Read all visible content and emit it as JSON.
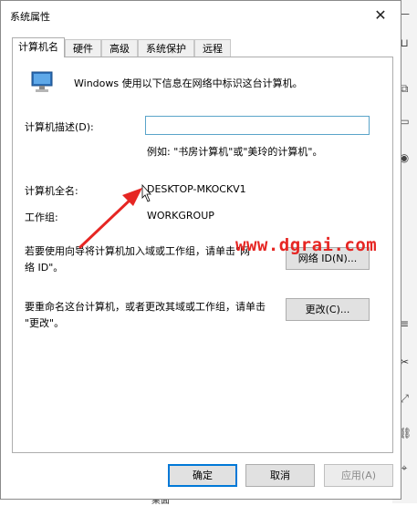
{
  "window": {
    "title": "系统属性",
    "close_glyph": "✕"
  },
  "tabs": [
    {
      "label": "计算机名",
      "active": true
    },
    {
      "label": "硬件",
      "active": false
    },
    {
      "label": "高级",
      "active": false
    },
    {
      "label": "系统保护",
      "active": false
    },
    {
      "label": "远程",
      "active": false
    }
  ],
  "intro_text": "Windows 使用以下信息在网络中标识这台计算机。",
  "description": {
    "label": "计算机描述(D):",
    "value": "",
    "example": "例如: \"书房计算机\"或\"美玲的计算机\"。"
  },
  "full_name": {
    "label": "计算机全名:",
    "value": "DESKTOP-MKOCKV1"
  },
  "workgroup": {
    "label": "工作组:",
    "value": "WORKGROUP"
  },
  "network_id": {
    "text_line1": "若要使用向导将计算机加入域或工作组，请单击\"网",
    "text_line2": "络 ID\"。",
    "button": "网络 ID(N)..."
  },
  "rename": {
    "text_line1": "要重命名这台计算机，或者更改其域或工作组，请单击",
    "text_line2": "\"更改\"。",
    "button": "更改(C)..."
  },
  "footer": {
    "ok": "确定",
    "cancel": "取消",
    "apply": "应用(A)"
  },
  "watermark": "www.dgrai.com",
  "background_peek_text": "桌面",
  "colors": {
    "focus_border": "#0078d7",
    "input_border": "#5aa4c9",
    "annotation": "#e62623"
  }
}
